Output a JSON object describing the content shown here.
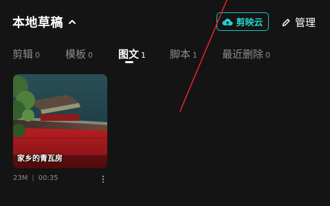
{
  "header": {
    "title": "本地草稿",
    "cloud_label": "剪映云",
    "manage_label": "管理"
  },
  "tabs": [
    {
      "label": "剪辑",
      "count": "0",
      "active": false
    },
    {
      "label": "模板",
      "count": "0",
      "active": false
    },
    {
      "label": "图文",
      "count": "1",
      "active": true
    },
    {
      "label": "脚本",
      "count": "1",
      "active": false
    },
    {
      "label": "最近删除",
      "count": "0",
      "active": false
    }
  ],
  "drafts": [
    {
      "title": "家乡的青瓦房",
      "size": "23M",
      "duration": "00:35"
    }
  ],
  "colors": {
    "background": "#141414",
    "accent": "#22d3cd",
    "inactive_text": "#8e8e8e",
    "annotation": "#e0262b"
  },
  "icons": {
    "title_chevron": "chevron-up-icon",
    "cloud": "cloud-upload-icon",
    "manage": "pencil-icon",
    "card_more": "more-vertical-icon"
  }
}
